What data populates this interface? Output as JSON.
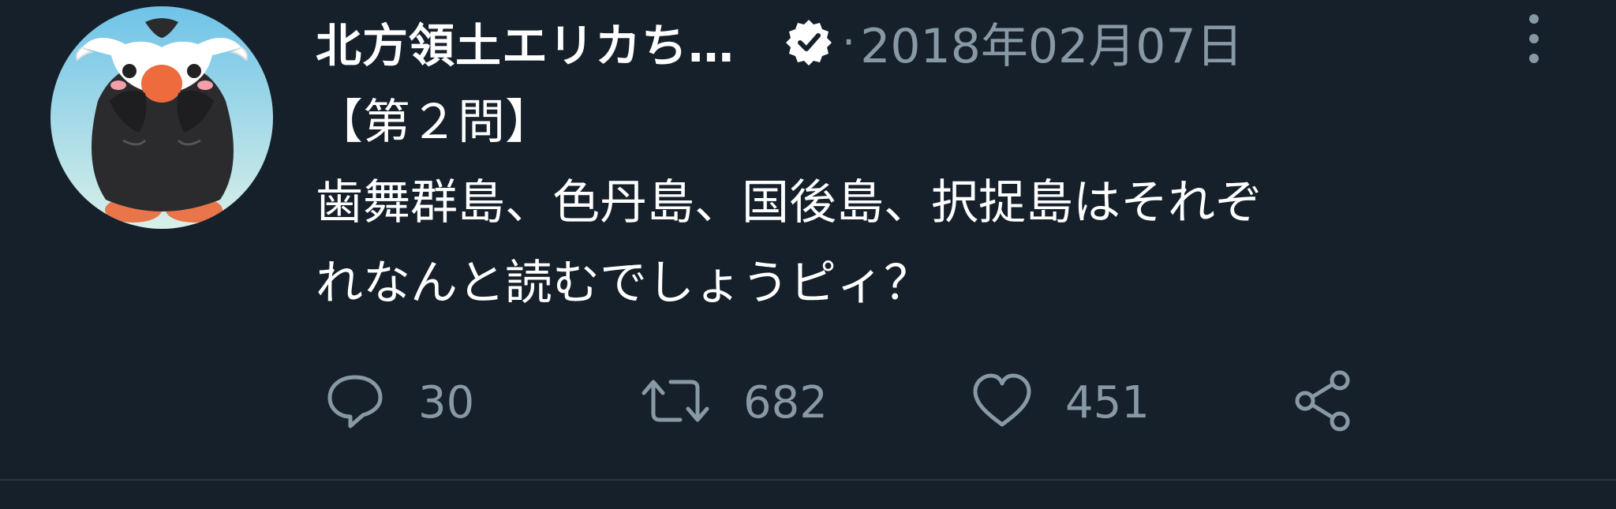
{
  "tweet": {
    "author_name": "北方領土エリカち…",
    "separator": "·",
    "date": "2018年02月07日",
    "body_lines": [
      "【第２問】",
      "歯舞群島、色丹島、国後島、択捉島はそれぞ",
      "れなんと読むでしょうピィ？"
    ],
    "stats": {
      "replies": "30",
      "retweets": "682",
      "likes": "451"
    }
  },
  "icons": {
    "avatar": "penguin-avatar",
    "verified": "verified-badge-icon",
    "more": "more-vertical-icon",
    "reply": "reply-icon",
    "retweet": "retweet-icon",
    "like": "heart-icon",
    "share": "share-icon"
  },
  "colors": {
    "background": "#16202a",
    "text_primary": "#ffffff",
    "text_secondary": "#8899a6",
    "divider": "#2a3640"
  }
}
